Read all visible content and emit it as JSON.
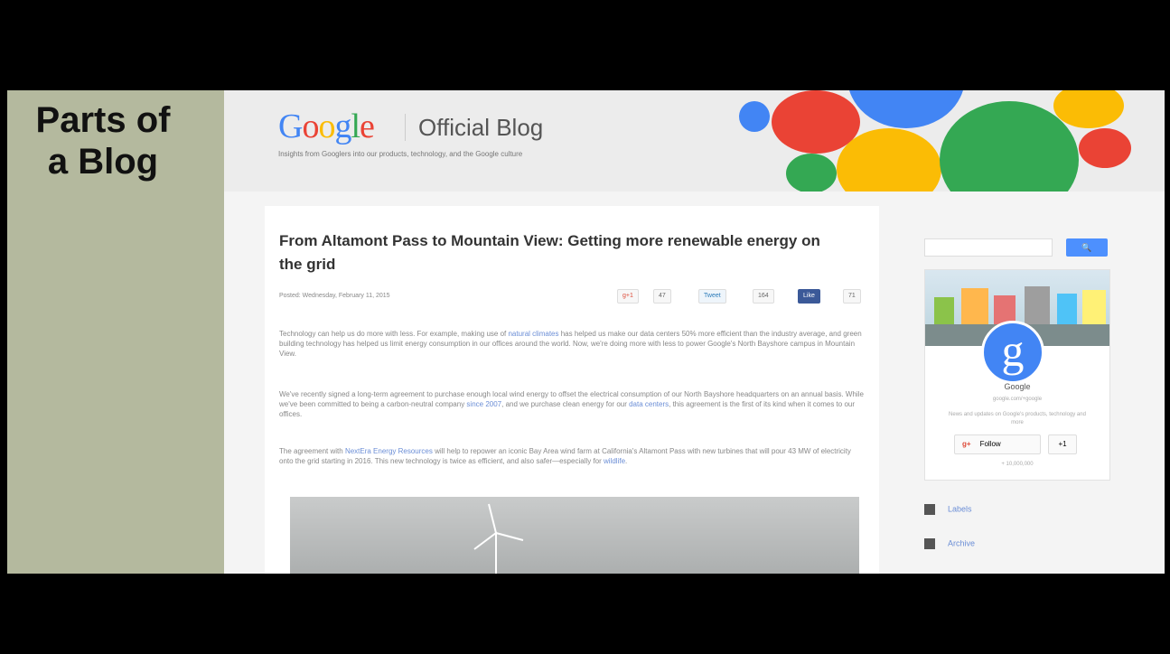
{
  "slide": {
    "title_line1": "Parts of",
    "title_line2": "a Blog"
  },
  "blog": {
    "logo_letters": [
      "G",
      "o",
      "o",
      "g",
      "l",
      "e"
    ],
    "logo_colors": [
      "#4285f4",
      "#ea4335",
      "#fbbc05",
      "#4285f4",
      "#34a853",
      "#ea4335"
    ],
    "name": "Official Blog",
    "tagline": "Insights from Googlers into our products, technology, and the Google culture",
    "bubble_colors": {
      "blue": "#4285f4",
      "red": "#ea4335",
      "yellow": "#fbbc05",
      "green": "#34a853"
    }
  },
  "post": {
    "title": "From Altamont Pass to Mountain View: Getting more renewable energy on the grid",
    "meta": "Posted: Wednesday, February 11, 2015",
    "share": {
      "gplus_label": "g+1",
      "gplus_count": "47",
      "tweet_label": "Tweet",
      "tweet_count": "164",
      "like_label": "Like",
      "like_count": "71"
    },
    "p1_a": "Technology can help us do more with less. For example, making use of ",
    "p1_link": "natural climates",
    "p1_b": " has helped us make our data centers 50% more efficient than the industry average, and green building technology has helped us limit energy consumption in our offices around the world. Now, we're doing more with less to power Google's North Bayshore campus in Mountain View.",
    "p2_a": "We've recently signed a long-term agreement to purchase enough local wind energy to offset the electrical consumption of our North Bayshore headquarters on an annual basis. While we've been committed to being a carbon-neutral company ",
    "p2_link1": "since 2007",
    "p2_b": ", and we purchase clean energy for our ",
    "p2_link2": "data centers",
    "p2_c": ", this agreement is the first of its kind when it comes to our offices.",
    "p3_a": "The agreement with ",
    "p3_link1": "NextEra Energy Resources",
    "p3_b": " will help to repower an iconic Bay Area wind farm at California's Altamont Pass with new turbines that will pour 43 MW of electricity onto the grid starting in 2016. This new technology is twice as efficient, and also safer—especially for ",
    "p3_link2": "wildlife",
    "p3_c": "."
  },
  "sidebar": {
    "search_button": "🔍",
    "card": {
      "avatar": "g",
      "name": "Google",
      "url": "google.com/+google",
      "description": "News and updates on Google's products, technology and more",
      "follow_icon": "g+",
      "follow_label": "Follow",
      "plus_label": "+1",
      "followers": "+ 10,000,000"
    },
    "links": {
      "labels": "Labels",
      "archive": "Archive"
    }
  }
}
